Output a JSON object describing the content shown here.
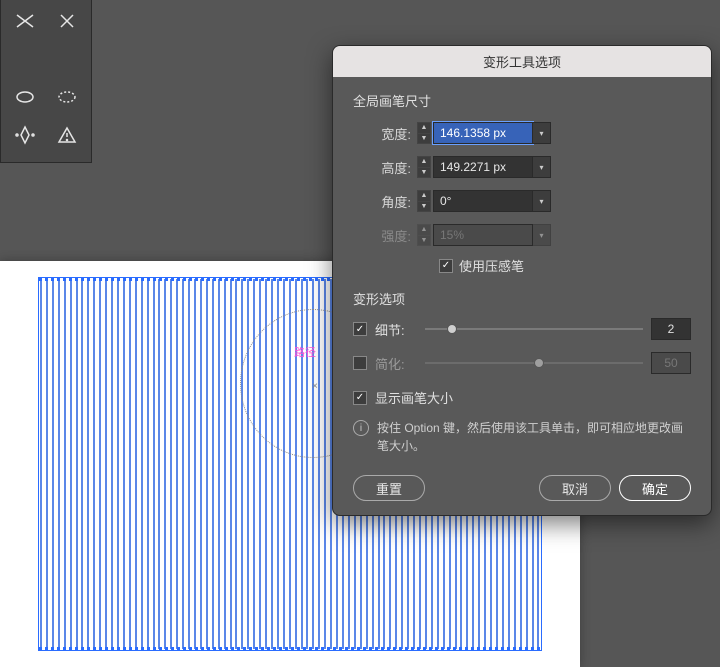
{
  "tool_palette": {
    "items": [
      "scissors",
      "close",
      "blank",
      "blank",
      "ellipse",
      "starburst",
      "anchor-convert",
      "warning"
    ]
  },
  "canvas": {
    "brush_label": "路径"
  },
  "dialog": {
    "title": "变形工具选项",
    "sections": {
      "global_brush": "全局画笔尺寸",
      "warp_options": "变形选项"
    },
    "fields": {
      "width_label": "宽度:",
      "width_value": "146.1358 px",
      "height_label": "高度:",
      "height_value": "149.2271 px",
      "angle_label": "角度:",
      "angle_value": "0°",
      "intensity_label": "强度:",
      "intensity_value": "15%"
    },
    "use_pressure_pen_label": "使用压感笔",
    "use_pressure_pen_checked": true,
    "options": {
      "detail_label": "细节:",
      "detail_checked": true,
      "detail_value": "2",
      "simplify_label": "简化:",
      "simplify_checked": false,
      "simplify_value": "50"
    },
    "show_brush_size_label": "显示画笔大小",
    "show_brush_size_checked": true,
    "info_text": "按住 Option 键，然后使用该工具单击，即可相应地更改画笔大小。",
    "buttons": {
      "reset": "重置",
      "cancel": "取消",
      "ok": "确定"
    }
  }
}
